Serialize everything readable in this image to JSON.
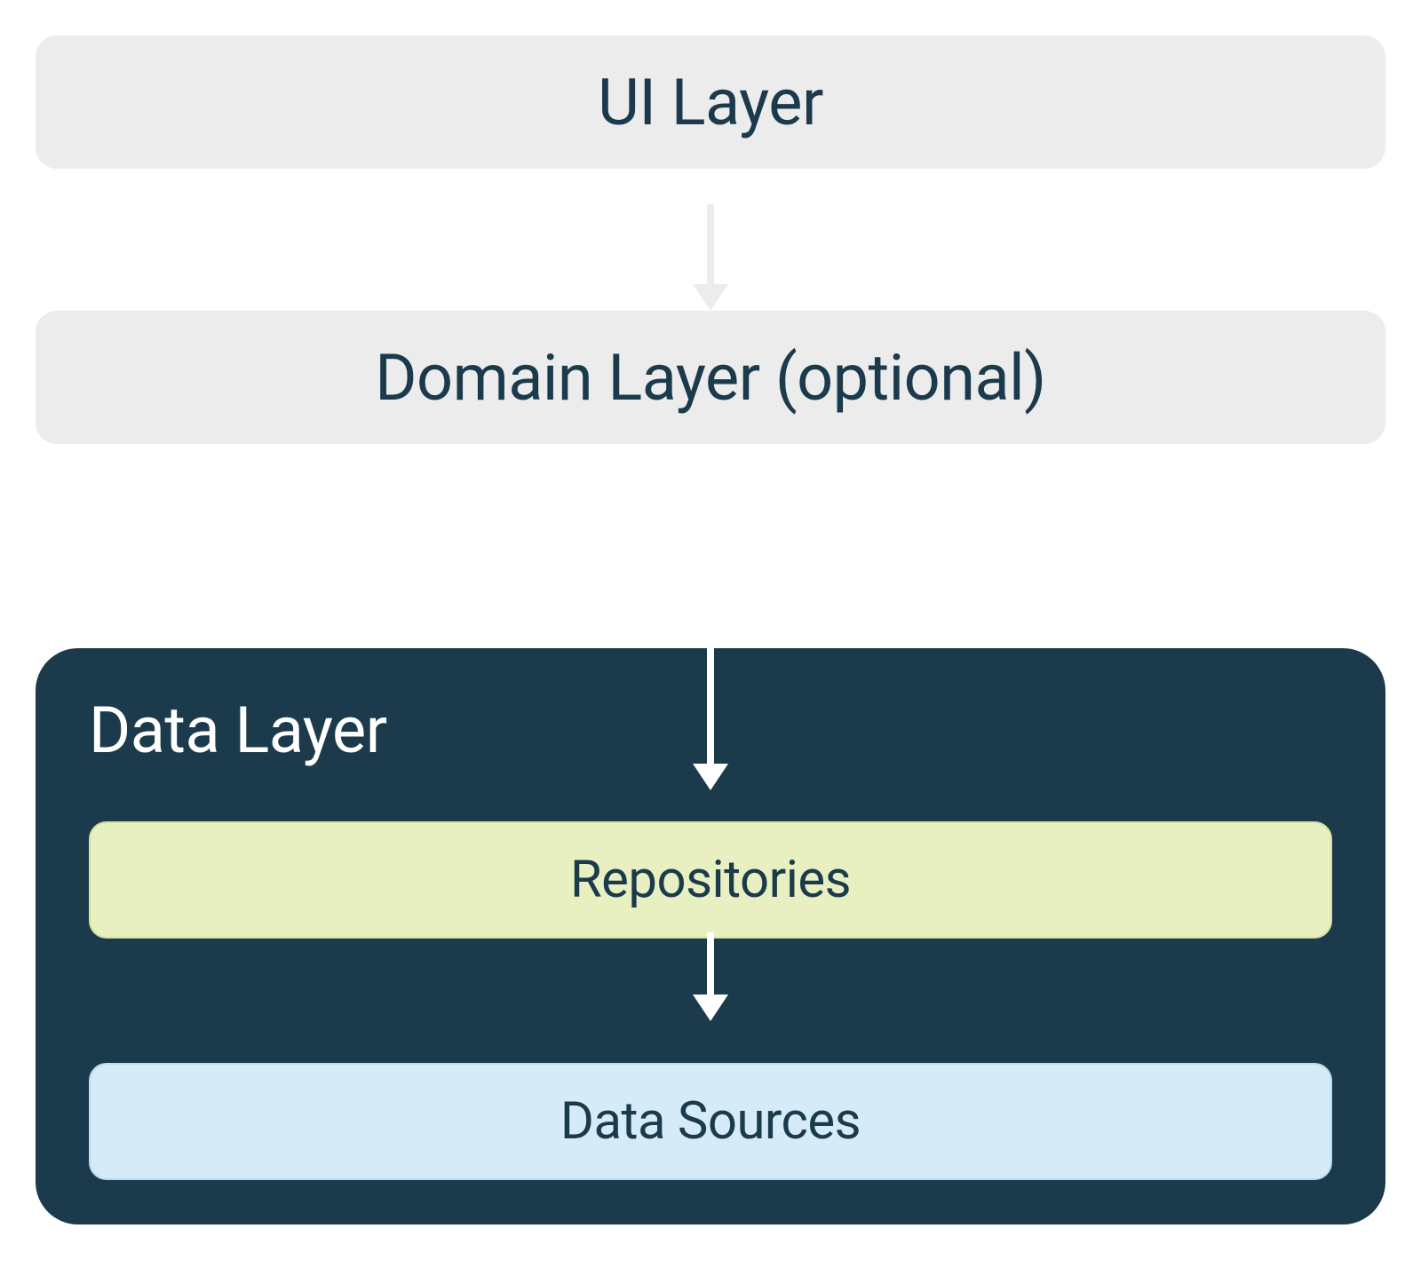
{
  "diagram": {
    "layers": {
      "ui": {
        "label": "UI Layer"
      },
      "domain": {
        "label": "Domain Layer (optional)"
      },
      "data": {
        "title": "Data Layer",
        "repositories": {
          "label": "Repositories"
        },
        "dataSources": {
          "label": "Data Sources"
        }
      }
    },
    "colors": {
      "lightGray": "#ececec",
      "darkBlue": "#1b3a4b",
      "lightGreen": "#e8f0c2",
      "lightBlue": "#d6ebf8",
      "white": "#ffffff"
    }
  }
}
